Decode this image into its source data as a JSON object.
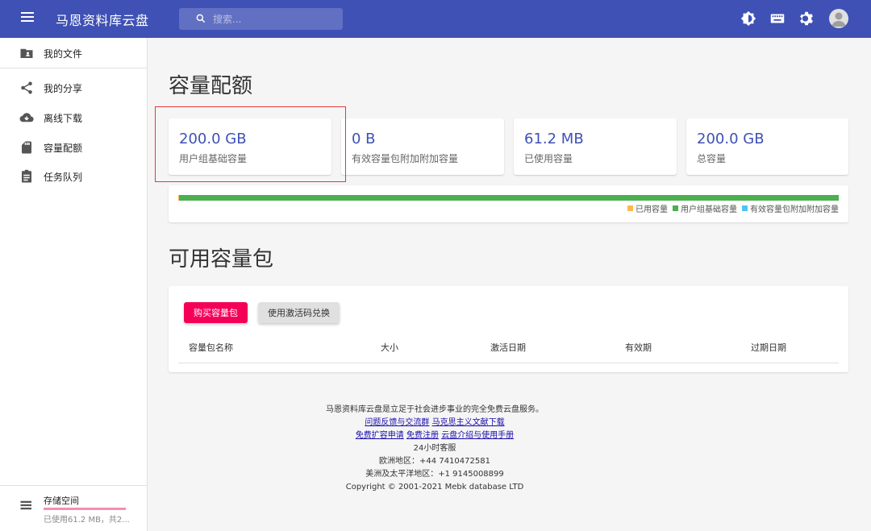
{
  "app": {
    "title": "马恩资料库云盘"
  },
  "search": {
    "placeholder": "搜索..."
  },
  "toolbar": {
    "icons": [
      "theme-icon",
      "keyboard-icon",
      "settings-icon",
      "account-icon"
    ]
  },
  "sidebar": {
    "items": [
      {
        "label": "我的文件",
        "icon": "folder-account-icon"
      },
      {
        "label": "我的分享",
        "icon": "share-icon"
      },
      {
        "label": "离线下载",
        "icon": "cloud-download-icon"
      },
      {
        "label": "容量配额",
        "icon": "sd-card-icon"
      },
      {
        "label": "任务队列",
        "icon": "assignment-icon"
      }
    ],
    "storage": {
      "title": "存储空间",
      "usage": "已使用61.2 MB，共2...",
      "used_fraction": 0.0003
    }
  },
  "main": {
    "quota_title": "容量配额",
    "cards": [
      {
        "value": "200.0 GB",
        "label": "用户组基础容量"
      },
      {
        "value": "0 B",
        "label": "有效容量包附加附加容量"
      },
      {
        "value": "61.2 MB",
        "label": "已使用容量"
      },
      {
        "value": "200.0 GB",
        "label": "总容量"
      }
    ],
    "bar": {
      "used_fraction": 0.0003,
      "legend": [
        {
          "label": "已用容量",
          "color": "#ffb74d"
        },
        {
          "label": "用户组基础容量",
          "color": "#4caf50"
        },
        {
          "label": "有效容量包附加附加容量",
          "color": "#4fc3f7"
        }
      ]
    },
    "packs_title": "可用容量包",
    "buy_button": "购买容量包",
    "code_button": "使用激活码兑换",
    "table_headers": [
      "容量包名称",
      "大小",
      "激活日期",
      "有效期",
      "过期日期"
    ]
  },
  "footer": {
    "line1": "马恩资料库云盘是立足于社会进步事业的完全免费云盘服务。",
    "link_feedback": "问题反馈与交流群",
    "link_docs": "马克思主义文献下载",
    "link_expand": "免费扩容申请",
    "link_register": "免费注册",
    "link_manual": "云盘介绍与使用手册",
    "service": "24小时客服",
    "europe": "欧洲地区：+44 7410472581",
    "americas": "美洲及太平洋地区：+1 9145008899",
    "copyright": "Copyright © 2001-2021 Mebk database LTD"
  },
  "colors": {
    "primary": "#3f51b5",
    "accent": "#f50057",
    "highlight": "#e53935"
  }
}
